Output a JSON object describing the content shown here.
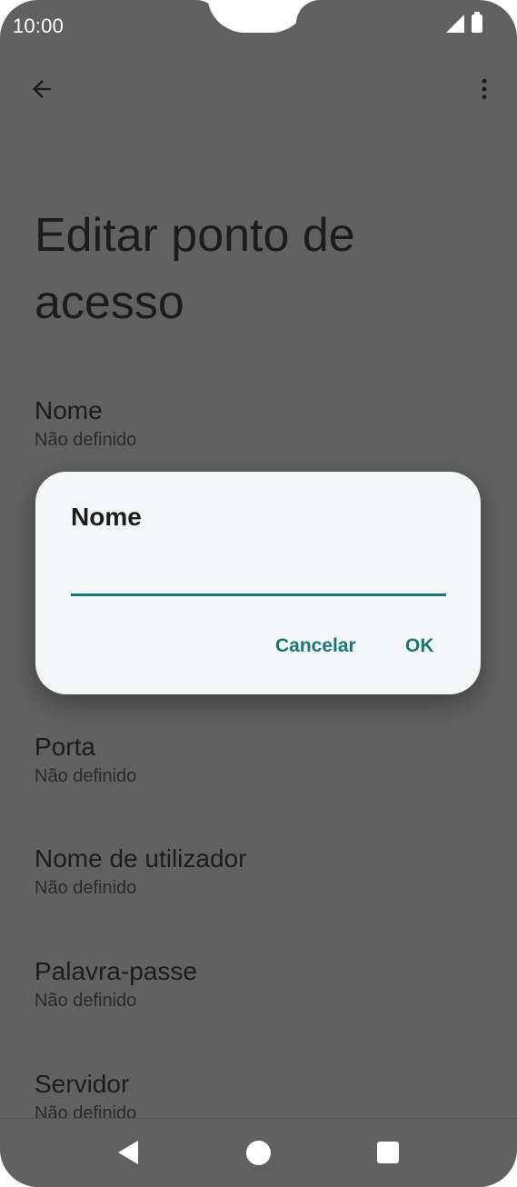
{
  "status_bar": {
    "time": "10:00",
    "icons": [
      "signal-icon",
      "battery-icon"
    ]
  },
  "toolbar": {
    "back_icon": "arrow-left-icon",
    "more_icon": "more-vert-icon"
  },
  "page": {
    "title": "Editar ponto de acesso"
  },
  "preferences": [
    {
      "title": "Nome",
      "summary": "Não definido"
    },
    {
      "title": "Porta",
      "summary": "Não definido"
    },
    {
      "title": "Nome de utilizador",
      "summary": "Não definido"
    },
    {
      "title": "Palavra-passe",
      "summary": "Não definido"
    },
    {
      "title": "Servidor",
      "summary": "Não definido"
    }
  ],
  "dialog": {
    "title": "Nome",
    "input_value": "",
    "cancel_label": "Cancelar",
    "ok_label": "OK"
  },
  "colors": {
    "scrim_background": "#606160",
    "dialog_background": "#f3f7f7",
    "accent": "#1a7874"
  },
  "nav_bar": {
    "icons": [
      "nav-back-icon",
      "nav-home-icon",
      "nav-recents-icon"
    ]
  }
}
